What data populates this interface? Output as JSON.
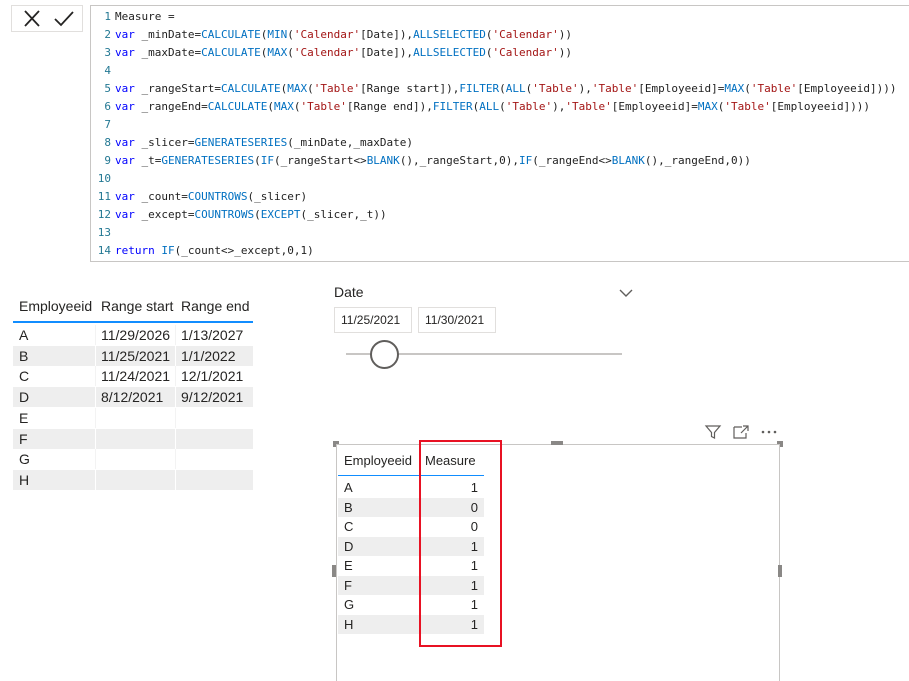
{
  "formula_bar": {
    "lines": [
      {
        "n": "1",
        "text": "Measure ="
      },
      {
        "n": "2",
        "text": "var _minDate=CALCULATE(MIN('Calendar'[Date]),ALLSELECTED('Calendar'))"
      },
      {
        "n": "3",
        "text": "var _maxDate=CALCULATE(MAX('Calendar'[Date]),ALLSELECTED('Calendar'))"
      },
      {
        "n": "4",
        "text": ""
      },
      {
        "n": "5",
        "text": "var _rangeStart=CALCULATE(MAX('Table'[Range start]),FILTER(ALL('Table'),'Table'[Employeeid]=MAX('Table'[Employeeid])))"
      },
      {
        "n": "6",
        "text": "var _rangeEnd=CALCULATE(MAX('Table'[Range end]),FILTER(ALL('Table'),'Table'[Employeeid]=MAX('Table'[Employeeid])))"
      },
      {
        "n": "7",
        "text": ""
      },
      {
        "n": "8",
        "text": "var _slicer=GENERATESERIES(_minDate,_maxDate)"
      },
      {
        "n": "9",
        "text": "var _t=GENERATESERIES(IF(_rangeStart<>BLANK(),_rangeStart,0),IF(_rangeEnd<>BLANK(),_rangeEnd,0))"
      },
      {
        "n": "10",
        "text": ""
      },
      {
        "n": "11",
        "text": "var _count=COUNTROWS(_slicer)"
      },
      {
        "n": "12",
        "text": "var _except=COUNTROWS(EXCEPT(_slicer,_t))"
      },
      {
        "n": "13",
        "text": ""
      },
      {
        "n": "14",
        "text": "return IF(_count<>_except,0,1)"
      }
    ]
  },
  "left_table": {
    "headers": [
      "Employeeid",
      "Range start",
      "Range end"
    ],
    "rows": [
      [
        "A",
        "11/29/2026",
        "1/13/2027"
      ],
      [
        "B",
        "11/25/2021",
        "1/1/2022"
      ],
      [
        "C",
        "11/24/2021",
        "12/1/2021"
      ],
      [
        "D",
        "8/12/2021",
        "9/12/2021"
      ],
      [
        "E",
        "",
        ""
      ],
      [
        "F",
        "",
        ""
      ],
      [
        "G",
        "",
        ""
      ],
      [
        "H",
        "",
        ""
      ]
    ]
  },
  "slicer": {
    "title": "Date",
    "start_date": "11/25/2021",
    "end_date": "11/30/2021"
  },
  "visual_table": {
    "headers": [
      "Employeeid",
      "Measure"
    ],
    "rows": [
      [
        "A",
        "1"
      ],
      [
        "B",
        "0"
      ],
      [
        "C",
        "0"
      ],
      [
        "D",
        "1"
      ],
      [
        "E",
        "1"
      ],
      [
        "F",
        "1"
      ],
      [
        "G",
        "1"
      ],
      [
        "H",
        "1"
      ]
    ]
  },
  "icons": {
    "cancel": "close-icon",
    "commit": "checkmark-icon",
    "chevron": "chevron-down-icon",
    "filter": "filter-icon",
    "focus": "focus-mode-icon",
    "more": "more-options-icon"
  },
  "colors": {
    "accent": "#118dff",
    "highlight": "#e81123",
    "keyword": "#0000ff",
    "function": "#0070c1",
    "string": "#a31515"
  }
}
